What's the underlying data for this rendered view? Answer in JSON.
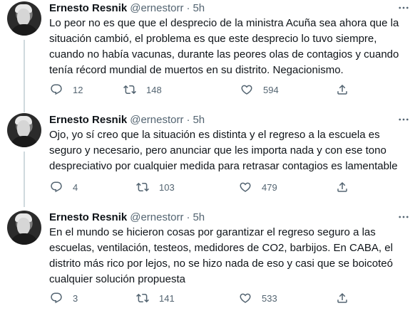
{
  "tweets": [
    {
      "author": {
        "name": "Ernesto Resnik",
        "handle": "@ernestorr"
      },
      "separator": "·",
      "time": "5h",
      "text": "Lo peor no es que que el desprecio de la ministra Acuña sea ahora que la\nsituación cambió, el problema es que este desprecio lo tuvo siempre,\ncuando no había vacunas, durante las peores olas de contagios y cuando\ntenía récord mundial de muertos en su distrito. Negacionismo.",
      "replies": "12",
      "retweets": "148",
      "likes": "594"
    },
    {
      "author": {
        "name": "Ernesto Resnik",
        "handle": "@ernestorr"
      },
      "separator": "·",
      "time": "5h",
      "text": "Ojo, yo sí creo que la situación es distinta y el regreso a la escuela es\nseguro y necesario, pero anunciar que les importa nada y con ese tono\ndespreciativo por cualquier medida para retrasar contagios es lamentable",
      "replies": "4",
      "retweets": "103",
      "likes": "479"
    },
    {
      "author": {
        "name": "Ernesto Resnik",
        "handle": "@ernestorr"
      },
      "separator": "·",
      "time": "5h",
      "text": "En el mundo se hicieron cosas por garantizar el regreso seguro a las\nescuelas, ventilación, testeos, medidores de CO2, barbijos. En CABA, el\ndistrito más rico por lejos, no se hizo nada de eso y casi que se boicoteó\ncualquier solución propuesta",
      "replies": "3",
      "retweets": "141",
      "likes": "533"
    }
  ],
  "icons": {
    "more": "more-horizontal-icon",
    "reply": "reply-icon",
    "retweet": "retweet-icon",
    "like": "heart-icon",
    "share": "share-icon"
  },
  "colors": {
    "text": "#0f1419",
    "secondary": "#536471",
    "thread_line": "#cfd9de"
  }
}
